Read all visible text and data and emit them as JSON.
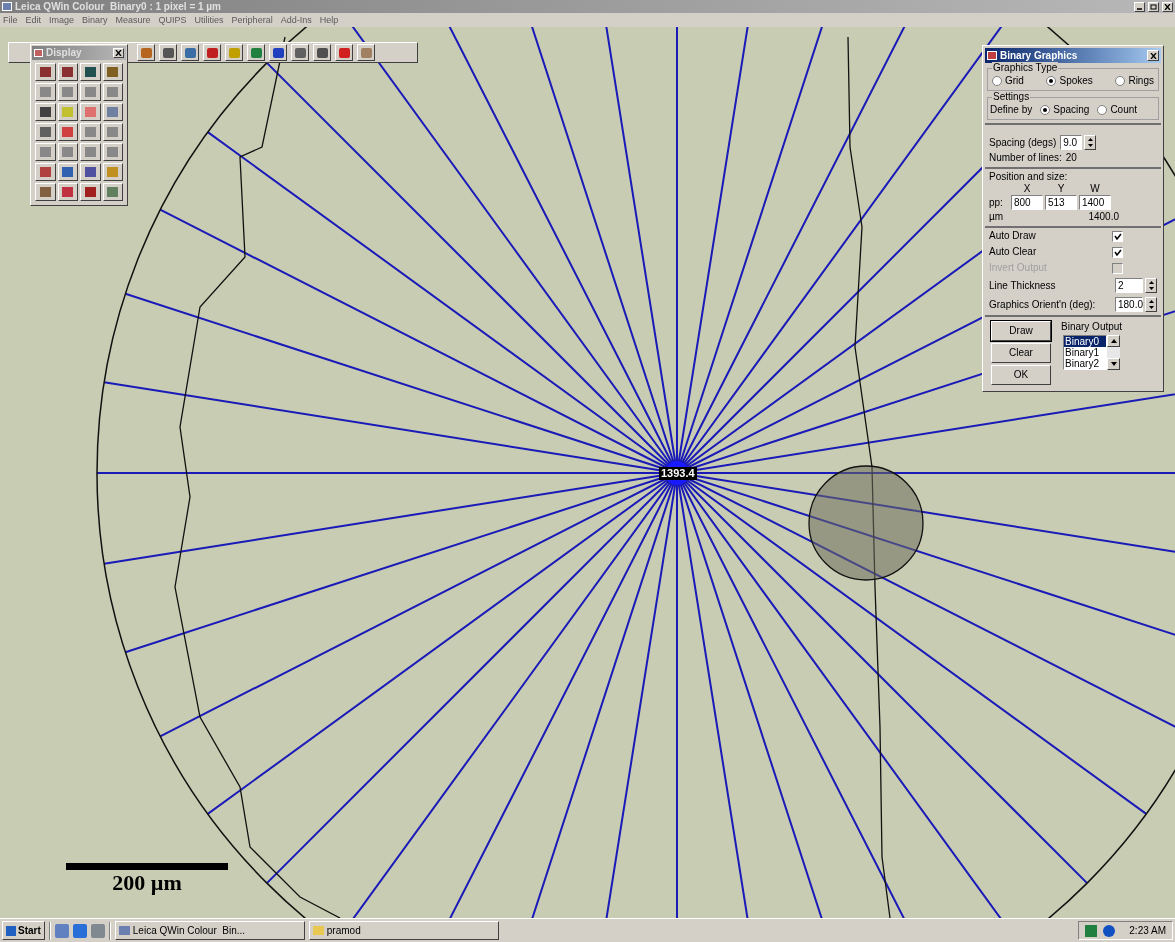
{
  "window": {
    "title": "Leica QWin Colour  Binary0 : 1 pixel = 1 µm"
  },
  "menu": [
    "File",
    "Edit",
    "Image",
    "Binary",
    "Measure",
    "QUIPS",
    "Utilities",
    "Peripheral",
    "Add-Ins",
    "Help"
  ],
  "display_palette": {
    "title": "Display"
  },
  "image": {
    "measurement": "1393.4",
    "scale_bar": "200 µm"
  },
  "dialog": {
    "title": "Binary Graphics",
    "graphics_type": {
      "legend": "Graphics Type",
      "options": [
        {
          "label": "Grid",
          "selected": false
        },
        {
          "label": "Spokes",
          "selected": true
        },
        {
          "label": "Rings",
          "selected": false
        }
      ]
    },
    "settings": {
      "legend": "Settings",
      "define_by": "Define by",
      "options": [
        {
          "label": "Spacing",
          "selected": true
        },
        {
          "label": "Count",
          "selected": false
        }
      ]
    },
    "spacing": {
      "label": "Spacing (degs)",
      "value": "9.0"
    },
    "lines": {
      "label": "Number of lines:",
      "value": "20"
    },
    "position": {
      "heading": "Position and size:",
      "columns": [
        "X",
        "Y",
        "W"
      ],
      "row_label": "pp:",
      "values": [
        "800",
        "513",
        "1400"
      ],
      "unit_label": "µm",
      "unit_value": "1400.0"
    },
    "options": [
      {
        "label": "Auto Draw",
        "checked": true,
        "disabled": false
      },
      {
        "label": "Auto Clear",
        "checked": true,
        "disabled": false
      },
      {
        "label": "Invert Output",
        "checked": false,
        "disabled": true
      }
    ],
    "line_thickness": {
      "label": "Line Thickness",
      "value": "2"
    },
    "orientation": {
      "label": "Graphics Orient'n (deg):",
      "value": "180.0"
    },
    "buttons": [
      {
        "label": "Draw",
        "default": true
      },
      {
        "label": "Clear",
        "default": false
      },
      {
        "label": "OK",
        "default": false
      }
    ],
    "binary_output": {
      "label": "Binary Output",
      "items": [
        {
          "label": "Binary0",
          "selected": true
        },
        {
          "label": "Binary1",
          "selected": false
        },
        {
          "label": "Binary2",
          "selected": false
        }
      ]
    }
  },
  "taskbar": {
    "start": "Start",
    "tasks": [
      "Leica QWin Colour  Bin...",
      "pramod"
    ],
    "clock": "2:23 AM"
  }
}
